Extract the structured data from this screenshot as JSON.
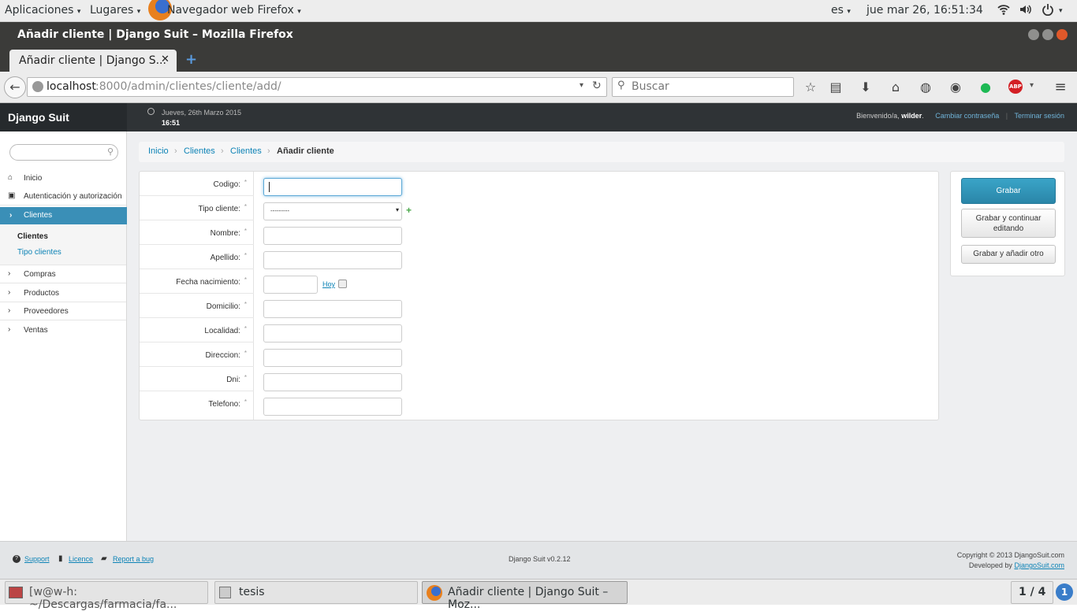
{
  "desktop": {
    "apps_menu": "Aplicaciones",
    "places_menu": "Lugares",
    "active_app": "Navegador web Firefox",
    "lang": "es",
    "clock": "jue mar 26, 16:51:34"
  },
  "window": {
    "title": "Añadir cliente | Django Suit – Mozilla Firefox"
  },
  "tab": {
    "label": "Añadir cliente | Django S..."
  },
  "browser": {
    "url_host": "localhost",
    "url_path": ":8000/admin/clientes/cliente/add/",
    "search_placeholder": "Buscar"
  },
  "suit": {
    "brand": "Django Suit",
    "date": "Jueves, 26th Marzo 2015",
    "time": "16:51",
    "welcome": "Bienvenido/a,",
    "user": "wilder",
    "change_password": "Cambiar contraseña",
    "logout": "Terminar sesión"
  },
  "sidebar": {
    "search_placeholder": "",
    "items": [
      {
        "label": "Inicio"
      },
      {
        "label": "Autenticación y autorización"
      },
      {
        "label": "Clientes"
      },
      {
        "label": "Compras"
      },
      {
        "label": "Productos"
      },
      {
        "label": "Proveedores"
      },
      {
        "label": "Ventas"
      }
    ],
    "sub": [
      {
        "label": "Clientes"
      },
      {
        "label": "Tipo clientes"
      }
    ]
  },
  "breadcrumb": {
    "home": "Inicio",
    "app": "Clientes",
    "model": "Clientes",
    "current": "Añadir cliente"
  },
  "form": {
    "fields": [
      {
        "label": "Codigo:"
      },
      {
        "label": "Tipo cliente:"
      },
      {
        "label": "Nombre:"
      },
      {
        "label": "Apellido:"
      },
      {
        "label": "Fecha nacimiento:"
      },
      {
        "label": "Domicilio:"
      },
      {
        "label": "Localidad:"
      },
      {
        "label": "Direccion:"
      },
      {
        "label": "Dni:"
      },
      {
        "label": "Telefono:"
      }
    ],
    "required_mark": "*",
    "tipo_cliente_selected": "---------",
    "today_link": "Hoy"
  },
  "actions": {
    "save": "Grabar",
    "save_continue_line1": "Grabar y continuar",
    "save_continue_line2": "editando",
    "save_add": "Grabar y añadir otro"
  },
  "footer": {
    "support": "Support",
    "licence": "Licence",
    "report": "Report a bug",
    "version": "Django Suit v0.2.12",
    "copyright": "Copyright © 2013 DjangoSuit.com",
    "developed_by": "Developed by",
    "developed_link": "DjangoSuit.com"
  },
  "taskbar": {
    "task1": "[w@w-h: ~/Descargas/farmacia/fa...",
    "task2": "tesis",
    "task3": "Añadir cliente | Django Suit – Moz...",
    "workspace": "1 / 4",
    "notify": "1"
  },
  "colors": {
    "primary": "#2a8fb3",
    "topbar": "#2f3336",
    "accent_link": "#0d83b6"
  }
}
